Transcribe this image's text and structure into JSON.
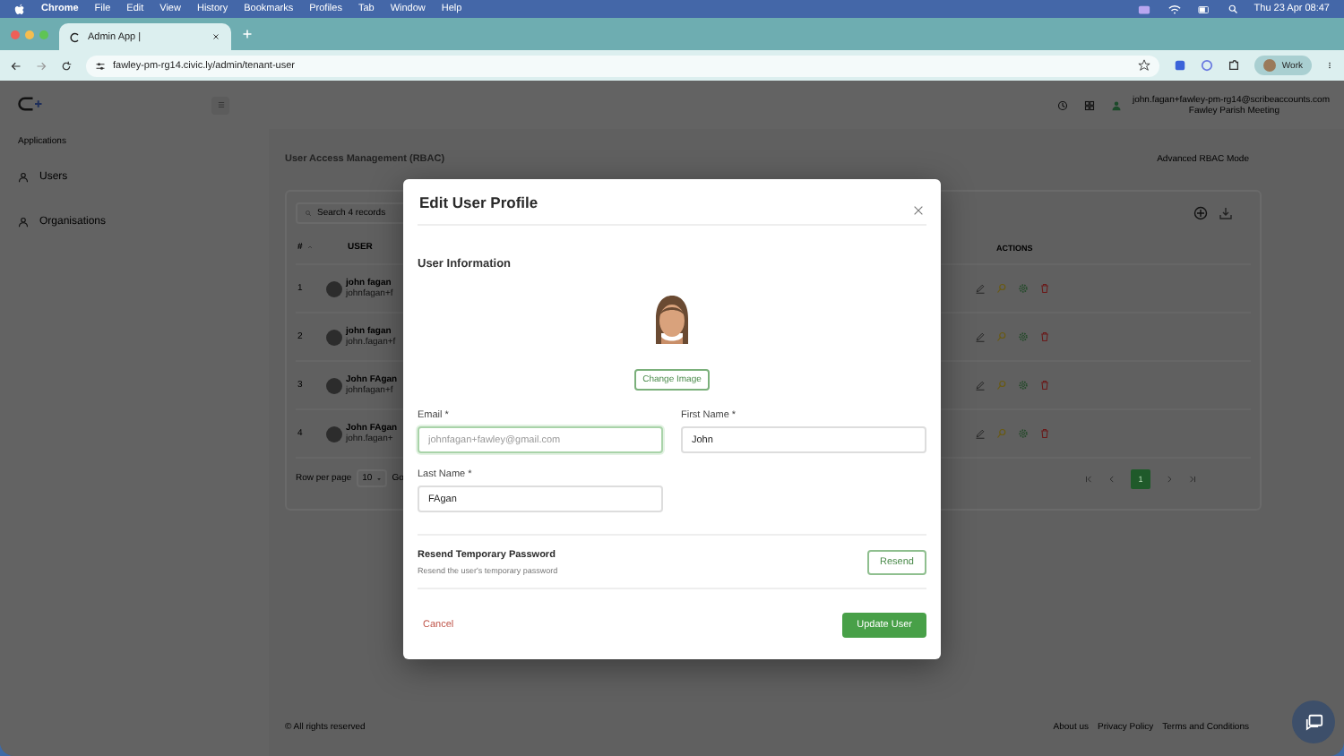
{
  "menu_bar": {
    "app": "Chrome",
    "items": [
      "File",
      "Edit",
      "View",
      "History",
      "Bookmarks",
      "Profiles",
      "Tab",
      "Window",
      "Help"
    ],
    "clock": "Thu 23 Apr  08:47"
  },
  "browser": {
    "tab_title": "Admin App |",
    "url": "fawley-pm-rg14.civic.ly/admin/tenant-user",
    "profile": "Work"
  },
  "header": {
    "user_email": "john.fagan+fawley-pm-rg14@scribeaccounts.com",
    "organisation": "Fawley Parish Meeting"
  },
  "sidebar": {
    "section": "Applications",
    "items": [
      "Users",
      "Organisations"
    ]
  },
  "page": {
    "title": "User Access Management (RBAC)",
    "mode": "Advanced RBAC Mode",
    "search_placeholder": "Search 4 records"
  },
  "table": {
    "columns": [
      "#",
      "USER",
      "ACTIONS"
    ],
    "rows": [
      {
        "index": "1",
        "name": "john fagan",
        "email": "johnfagan+f"
      },
      {
        "index": "2",
        "name": "john fagan",
        "email": "john.fagan+f"
      },
      {
        "index": "3",
        "name": "John FAgan",
        "email": "johnfagan+f"
      },
      {
        "index": "4",
        "name": "John FAgan",
        "email": "john.fagan+"
      }
    ]
  },
  "pagination": {
    "rows_per_page_label": "Row per page",
    "rows_per_page": "10",
    "goto": "Go",
    "pages": [
      {
        "label": "1",
        "selected": true
      }
    ]
  },
  "footer": {
    "copyright": "© All rights reserved",
    "links": [
      "About us",
      "Privacy Policy",
      "Terms and Conditions"
    ]
  },
  "modal": {
    "title": "Edit User Profile",
    "section": "User Information",
    "change_image": "Change Image",
    "fields": [
      {
        "label": "Email *",
        "placeholder": "johnfagan+fawley@gmail.com",
        "focused": true
      },
      {
        "label": "First Name *",
        "value": "John",
        "focused": false
      },
      {
        "label": "Last Name *",
        "value": "FAgan",
        "focused": false
      }
    ],
    "resend": {
      "title": "Resend Temporary Password",
      "description": "Resend the user's temporary password",
      "button": "Resend"
    },
    "cancel": "Cancel",
    "submit": "Update User"
  }
}
